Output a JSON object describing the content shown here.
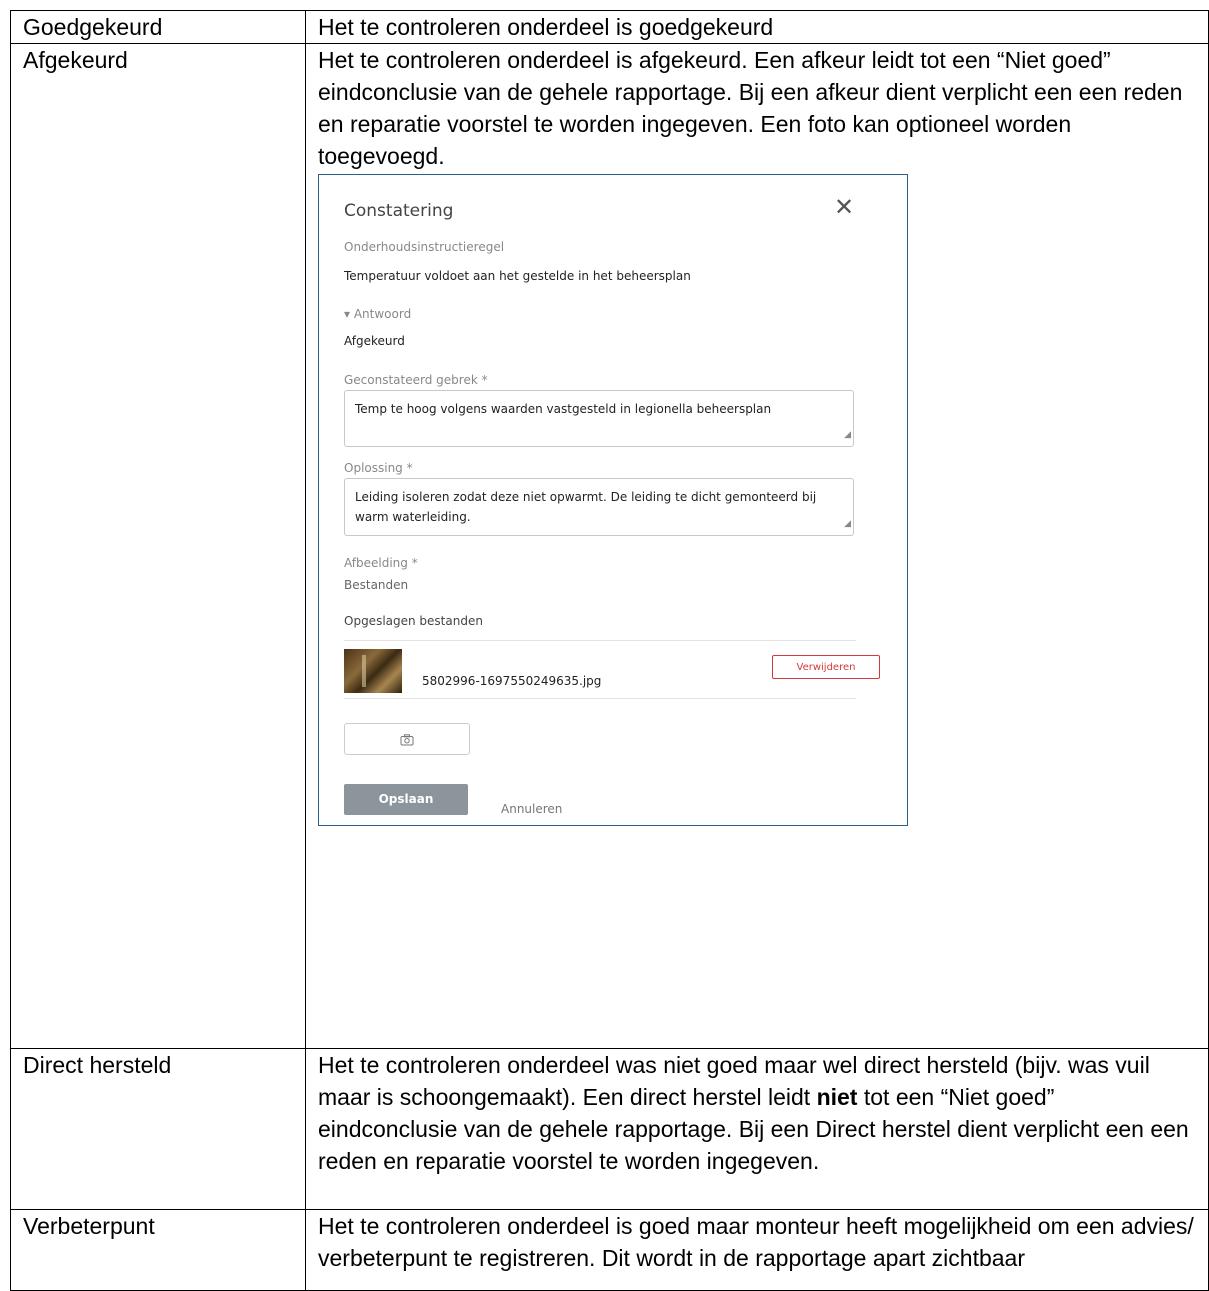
{
  "rows": [
    {
      "status": "Goedgekeurd",
      "description": "Het te controleren onderdeel is goedgekeurd"
    },
    {
      "status": "Afgekeurd",
      "description": "Het te controleren onderdeel is afgekeurd. Een afkeur leidt tot een “Niet goed” eindconclusie van de gehele rapportage. Bij een afkeur dient verplicht een een reden en reparatie voorstel te worden ingegeven. Een foto kan optioneel worden toegevoegd."
    },
    {
      "status": "Direct hersteld",
      "description_before": "Het te controleren onderdeel was niet goed maar wel direct hersteld (bijv. was vuil maar is schoongemaakt). Een direct herstel  leidt ",
      "description_bold": "niet",
      "description_after": " tot een “Niet goed” eindconclusie van de gehele rapportage. Bij een Direct herstel dient verplicht een een reden en reparatie voorstel te worden ingegeven."
    },
    {
      "status": "Verbeterpunt",
      "description": "Het te controleren onderdeel is goed maar monteur heeft mogelijkheid om een advies/ verbeterpunt te registreren. Dit wordt in de rapportage apart zichtbaar"
    }
  ],
  "dialog": {
    "title": "Constatering",
    "close_icon": "close-icon",
    "instruction_label": "Onderhoudsinstructieregel",
    "instruction_value": "Temperatuur voldoet aan het gestelde in het beheersplan",
    "answer_label": "▾ Antwoord",
    "answer_value": "Afgekeurd",
    "defect_label": "Geconstateerd gebrek *",
    "defect_value": "Temp te hoog volgens waarden vastgesteld in legionella beheersplan",
    "solution_label": "Oplossing *",
    "solution_value": "Leiding isoleren zodat deze niet opwarmt. De leiding te dicht gemonteerd bij warm waterleiding.",
    "image_label": "Afbeelding *",
    "files_label": "Bestanden",
    "saved_files_label": "Opgeslagen bestanden",
    "file_name": "5802996-1697550249635.jpg",
    "delete_label": "Verwijderen",
    "camera_icon": "camera-icon",
    "save_label": "Opslaan",
    "cancel_label": "Annuleren",
    "accent_color": "#2b5f8c",
    "delete_color": "#d23b3b"
  }
}
